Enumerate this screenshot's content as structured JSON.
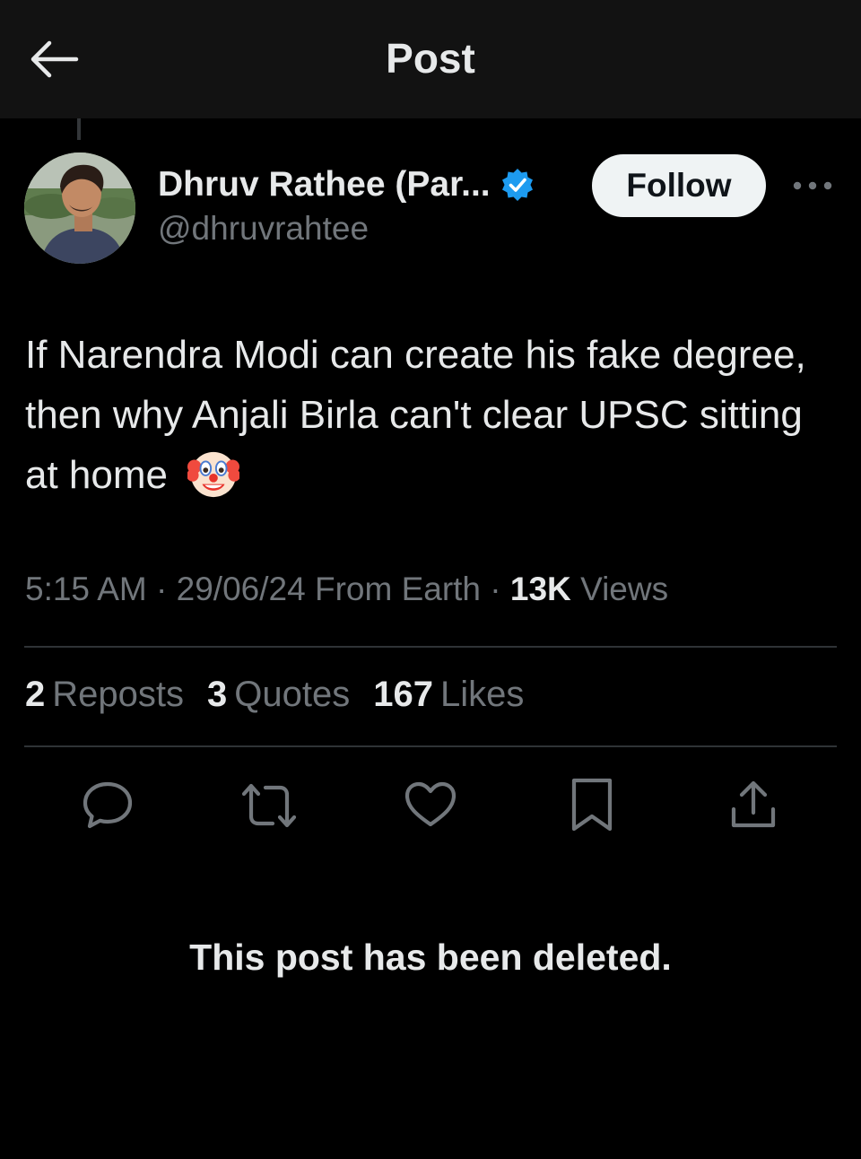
{
  "header": {
    "title": "Post",
    "back_icon": "arrow-left-icon"
  },
  "author": {
    "display_name": "Dhruv Rathee (Par...",
    "handle": "@dhruvrahtee",
    "verified": true,
    "verified_color": "#1d9bf0"
  },
  "follow_button": {
    "label": "Follow"
  },
  "post": {
    "text": "If Narendra Modi can create his fake degree, then why Anjali Birla can't clear UPSC sitting at home",
    "emoji": "clown-face"
  },
  "meta": {
    "time": "5:15 AM",
    "separator": "·",
    "date": "29/06/24",
    "location": "From Earth",
    "views_count": "13K",
    "views_label": "Views"
  },
  "stats": {
    "reposts_count": "2",
    "reposts_label": "Reposts",
    "quotes_count": "3",
    "quotes_label": "Quotes",
    "likes_count": "167",
    "likes_label": "Likes"
  },
  "actions": [
    "reply-icon",
    "repost-icon",
    "like-icon",
    "bookmark-icon",
    "share-icon"
  ],
  "deleted_notice": "This post has been deleted.",
  "colors": {
    "background": "#000000",
    "header_bg": "#121212",
    "text_primary": "#e7e9ea",
    "text_secondary": "#71767b",
    "divider": "#2f3336"
  }
}
